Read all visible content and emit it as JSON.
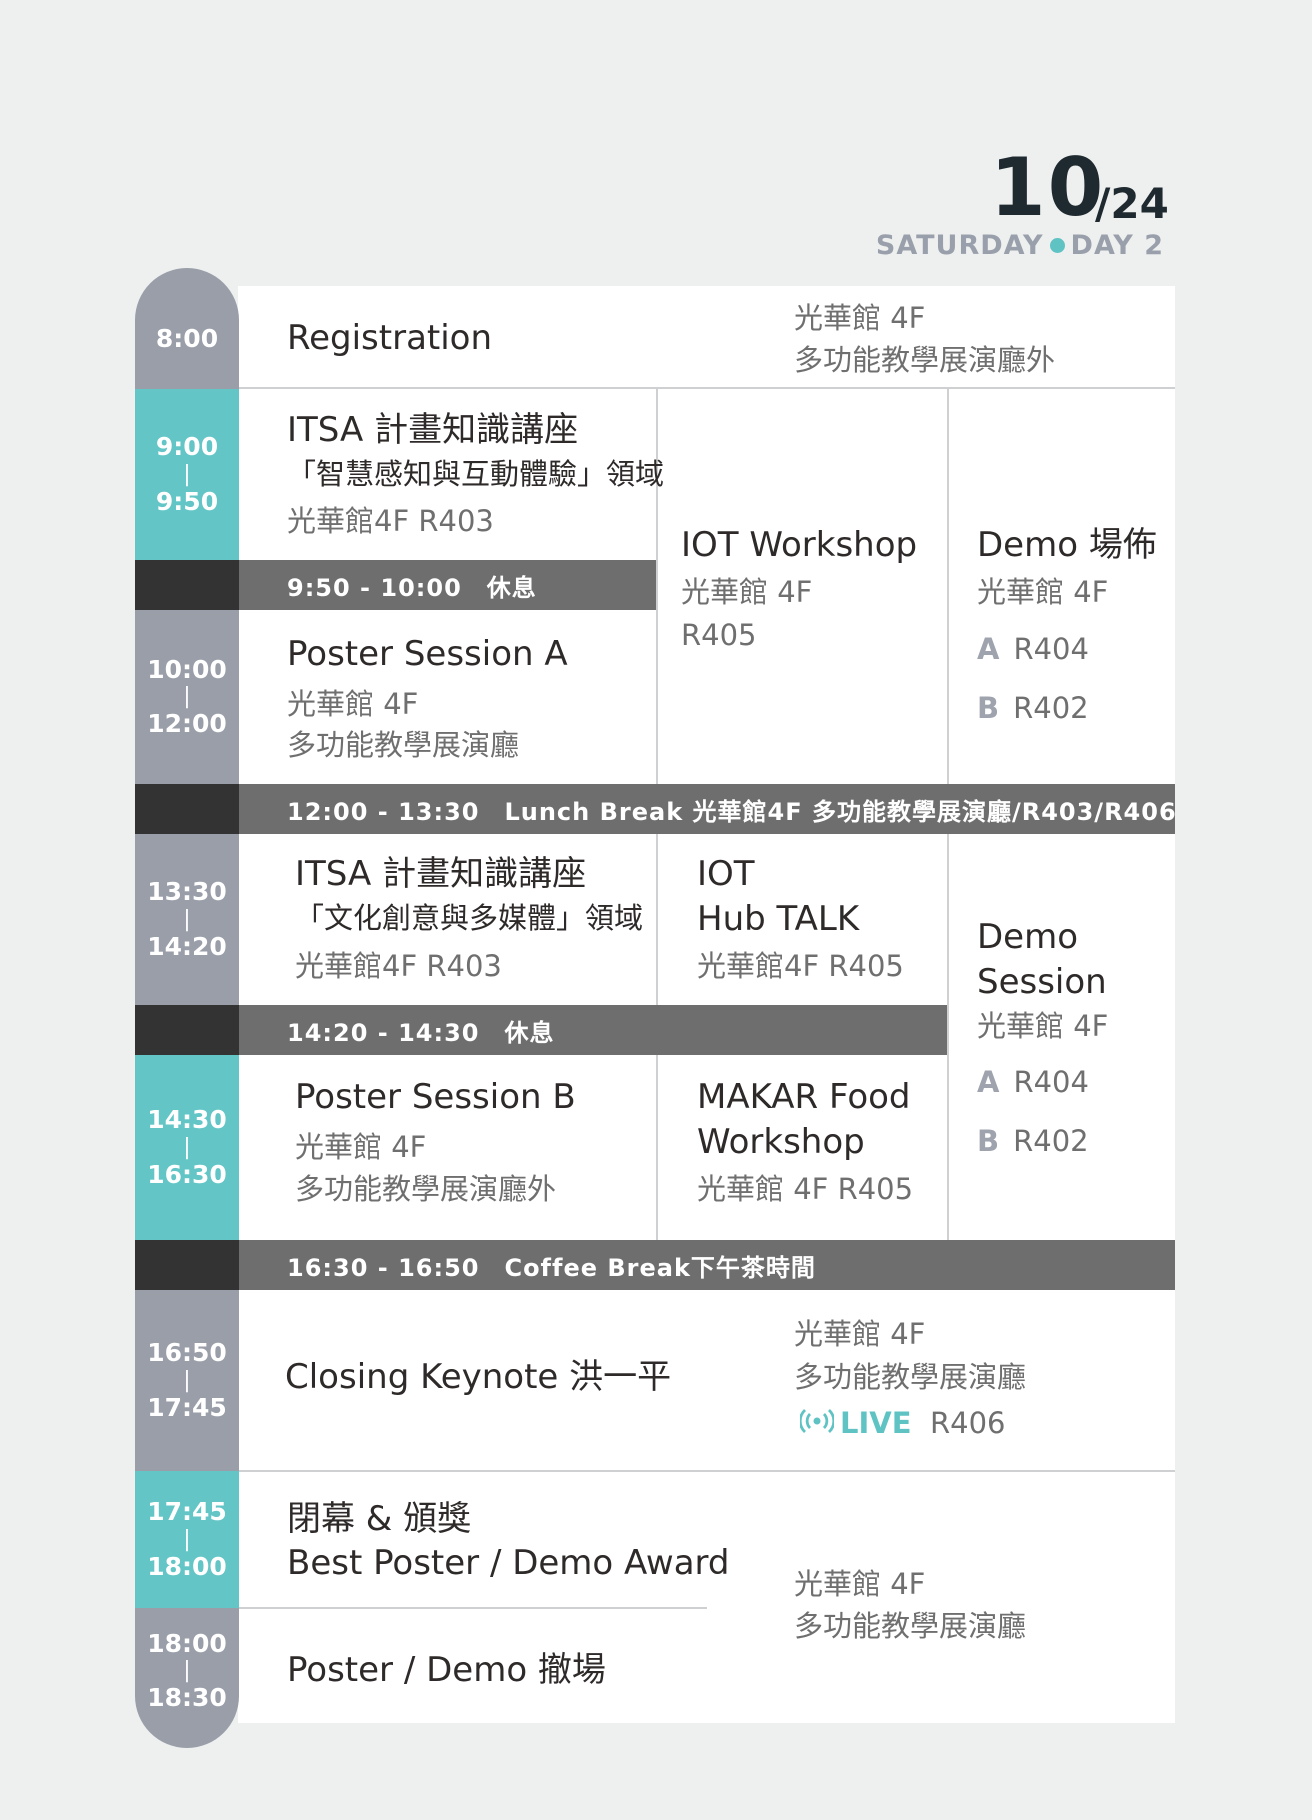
{
  "header": {
    "date_day": "10",
    "date_month": "/24",
    "weekday": "SATURDAY",
    "day_label": "DAY 2"
  },
  "colors": {
    "teal": "#63c5c6",
    "gray_time": "#999ea9",
    "dark": "#333333",
    "break_bar": "#6e6e6e"
  },
  "times": {
    "t1": "8:00",
    "t2_start": "9:00",
    "t2_end": "9:50",
    "t3_start": "10:00",
    "t3_end": "12:00",
    "t4_start": "13:30",
    "t4_end": "14:20",
    "t5_start": "14:30",
    "t5_end": "16:30",
    "t6_start": "16:50",
    "t6_end": "17:45",
    "t7_start": "17:45",
    "t7_end": "18:00",
    "t8_start": "18:00",
    "t8_end": "18:30",
    "sep": "|"
  },
  "breaks": {
    "b1": "9:50 - 10:00　休息",
    "b2": "12:00 - 13:30　Lunch Break 光華館4F 多功能教學展演廳/R403/R406",
    "b3": "14:20 - 14:30　休息",
    "b4": "16:30 - 16:50　Coffee Break下午茶時間"
  },
  "sessions": {
    "registration": {
      "title": "Registration",
      "loc1": "光華館  4F",
      "loc2": "多功能教學展演廳外"
    },
    "itsa1": {
      "title": "ITSA 計畫知識講座",
      "sub": "「智慧感知與互動體驗」領域",
      "loc": "光華館4F  R403"
    },
    "poster_a": {
      "title": "Poster Session A",
      "loc1": "光華館 4F",
      "loc2": "多功能教學展演廳"
    },
    "iot_workshop": {
      "title": "IOT  Workshop",
      "loc1": "光華館 4F",
      "loc2": "R405"
    },
    "demo_setup": {
      "title": "Demo 場佈",
      "loc": "光華館 4F",
      "a_label": "A",
      "a_room": "R404",
      "b_label": "B",
      "b_room": "R402"
    },
    "itsa2": {
      "title": "ITSA 計畫知識講座",
      "sub": "「文化創意與多媒體」領域",
      "loc": "光華館4F  R403"
    },
    "iot_hub": {
      "title1": "IOT",
      "title2": "Hub TALK",
      "loc": "光華館4F  R405"
    },
    "demo_session": {
      "title1": "Demo",
      "title2": "Session",
      "loc": "光華館 4F",
      "a_label": "A",
      "a_room": "R404",
      "b_label": "B",
      "b_room": "R402"
    },
    "poster_b": {
      "title": "Poster Session B",
      "loc1": "光華館 4F",
      "loc2": "多功能教學展演廳外"
    },
    "makar": {
      "title1": "MAKAR Food",
      "title2": "Workshop",
      "loc": "光華館 4F R405"
    },
    "closing": {
      "title": "Closing Keynote  洪一平",
      "loc1": "光華館  4F",
      "loc2": "多功能教學展演廳",
      "live_label": "LIVE",
      "live_room": "R406",
      "live_icon": "broadcast-icon"
    },
    "award": {
      "title": "閉幕 & 頒獎",
      "sub": "Best Poster / Demo Award",
      "loc1": "光華館  4F",
      "loc2": "多功能教學展演廳"
    },
    "teardown": {
      "title": "Poster / Demo 撤場"
    }
  }
}
